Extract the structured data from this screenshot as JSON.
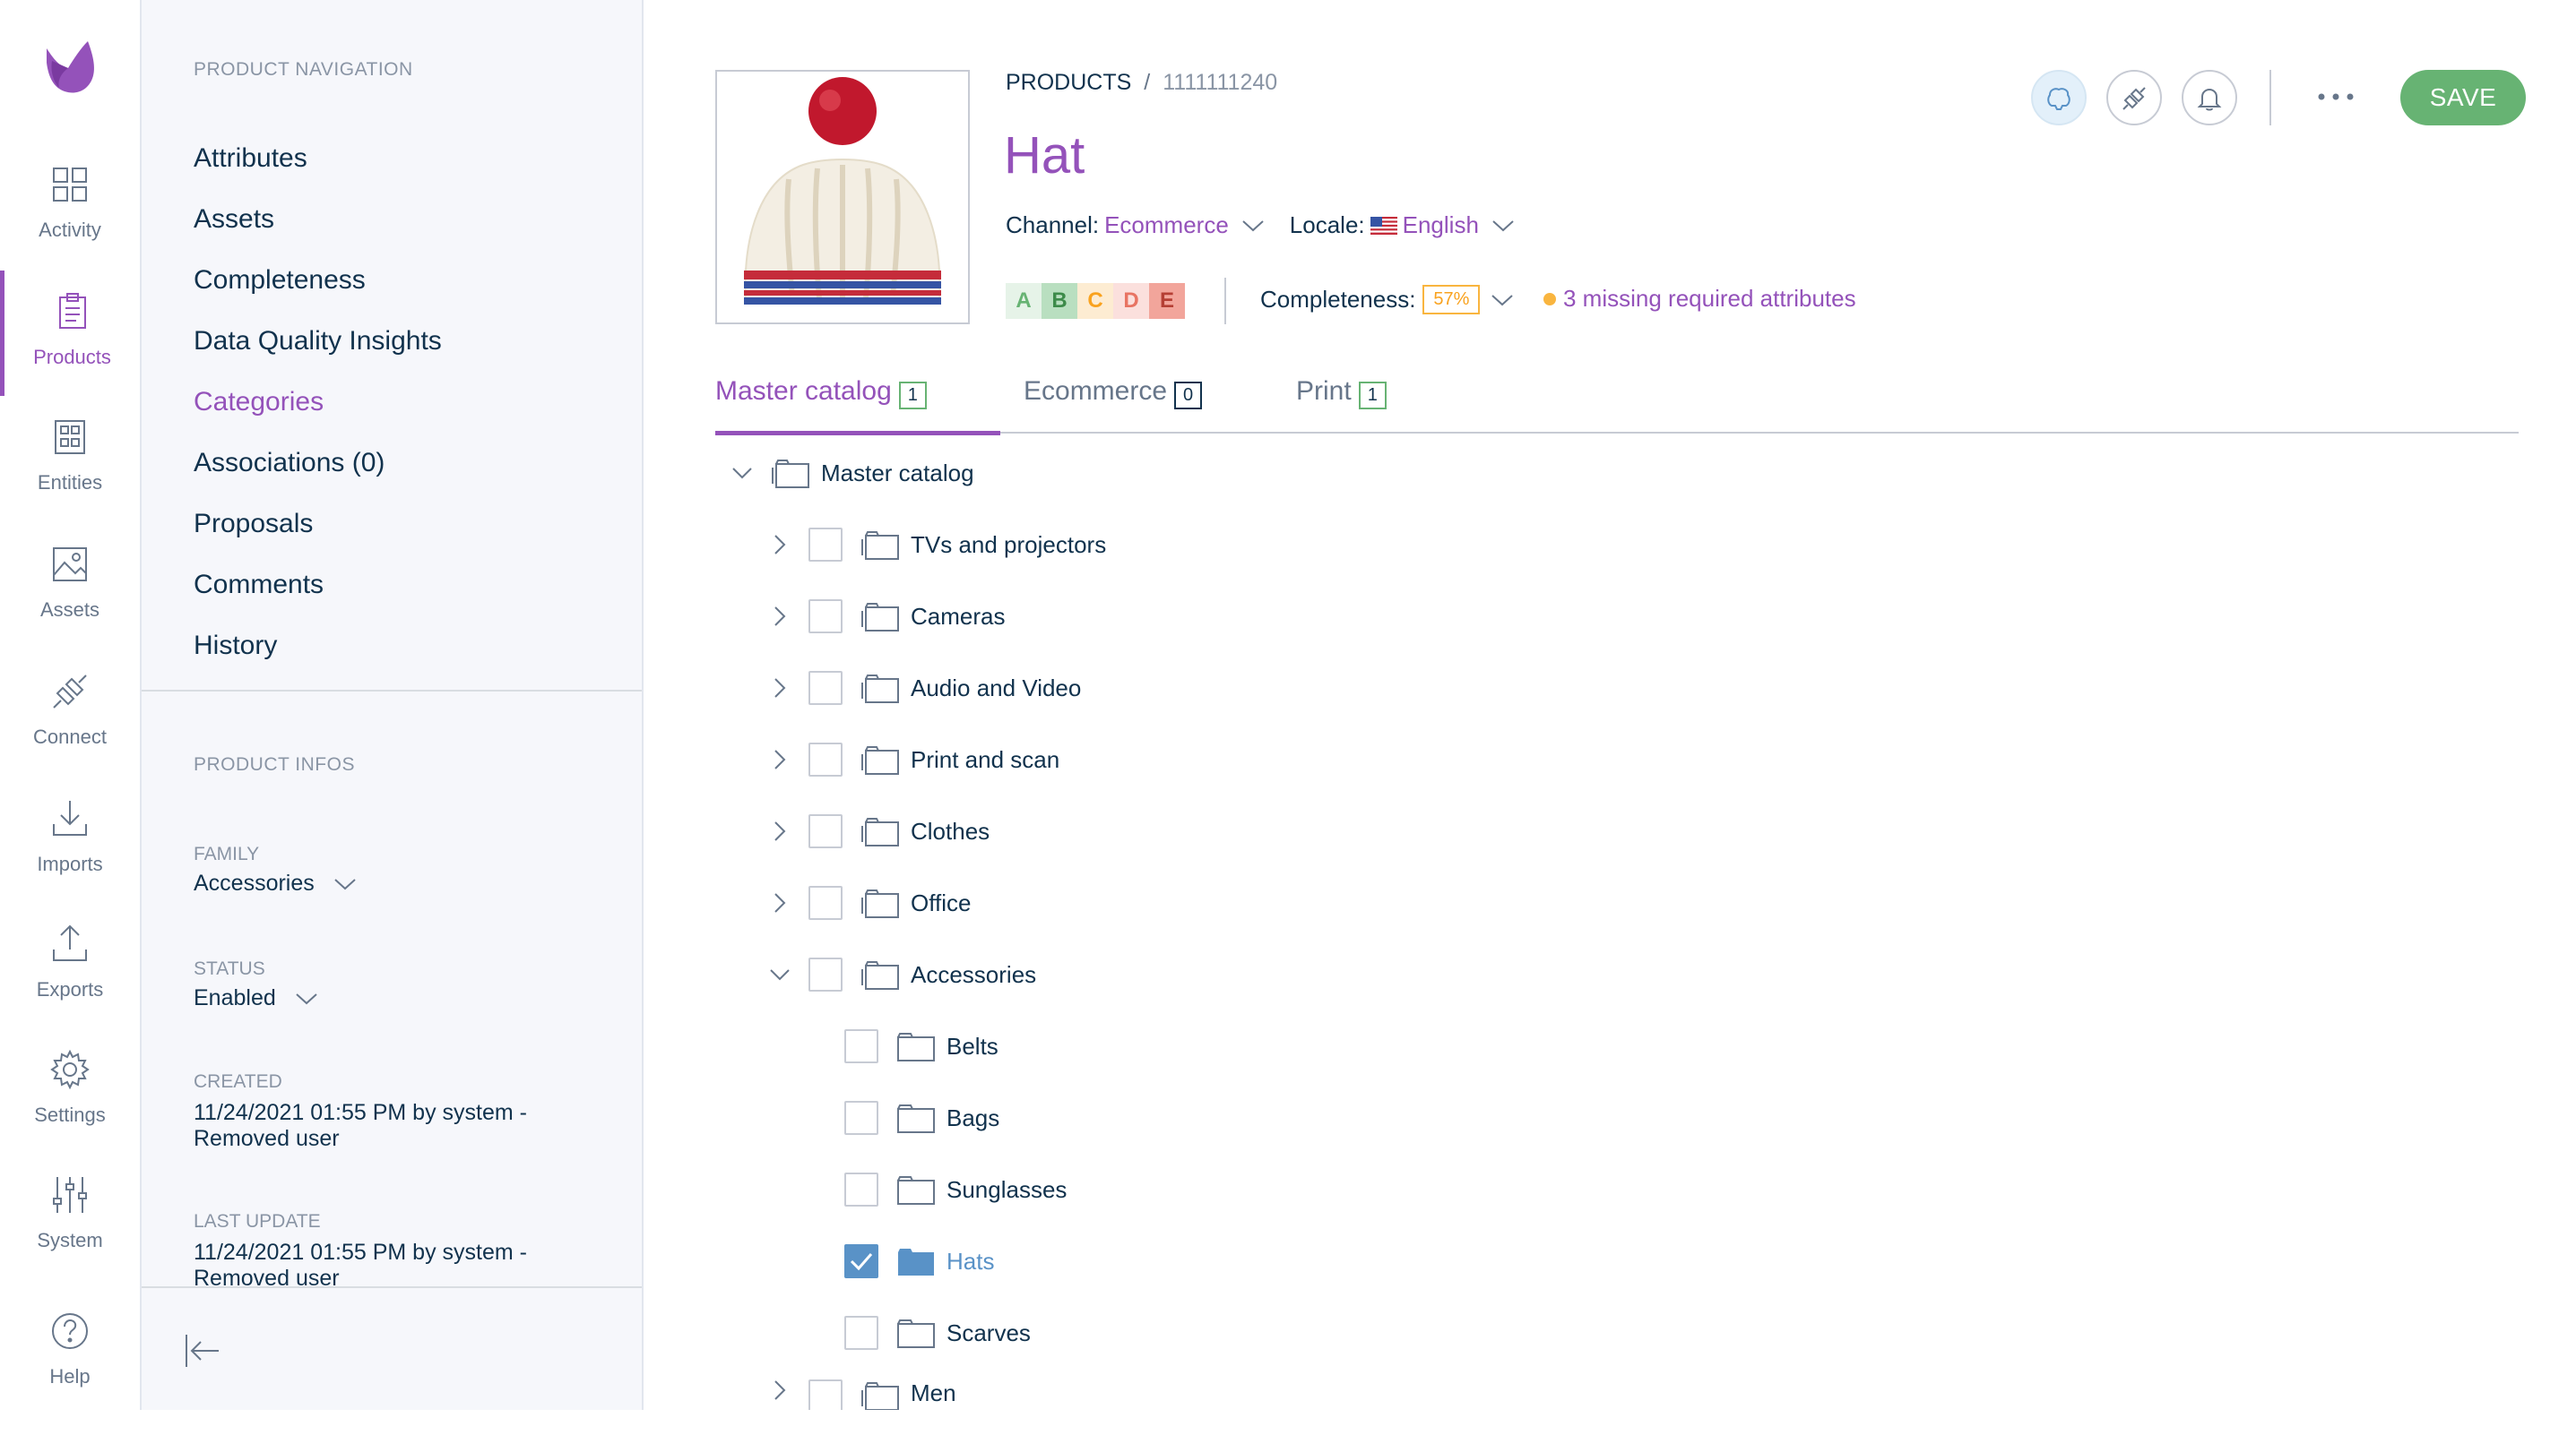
{
  "main_menu": {
    "items": [
      {
        "label": "Activity",
        "icon": "activity-icon"
      },
      {
        "label": "Products",
        "icon": "products-icon",
        "active": true
      },
      {
        "label": "Entities",
        "icon": "entities-icon"
      },
      {
        "label": "Assets",
        "icon": "assets-icon"
      },
      {
        "label": "Connect",
        "icon": "connect-icon"
      },
      {
        "label": "Imports",
        "icon": "imports-icon"
      },
      {
        "label": "Exports",
        "icon": "exports-icon"
      },
      {
        "label": "Settings",
        "icon": "settings-icon"
      },
      {
        "label": "System",
        "icon": "system-icon"
      }
    ],
    "help_label": "Help"
  },
  "product_nav": {
    "title": "PRODUCT NAVIGATION",
    "links": [
      {
        "label": "Attributes"
      },
      {
        "label": "Assets"
      },
      {
        "label": "Completeness"
      },
      {
        "label": "Data Quality Insights"
      },
      {
        "label": "Categories",
        "active": true
      },
      {
        "label": "Associations (0)"
      },
      {
        "label": "Proposals"
      },
      {
        "label": "Comments"
      },
      {
        "label": "History"
      }
    ]
  },
  "product_infos": {
    "title": "PRODUCT INFOS",
    "family_label": "FAMILY",
    "family_value": "Accessories",
    "status_label": "STATUS",
    "status_value": "Enabled",
    "created_label": "CREATED",
    "created_value": "11/24/2021 01:55 PM by system - Removed user",
    "updated_label": "LAST UPDATE",
    "updated_value": "11/24/2021 01:55 PM by system - Removed user"
  },
  "header": {
    "breadcrumb_root": "PRODUCTS",
    "breadcrumb_sep": "/",
    "breadcrumb_code": "1111111240",
    "title": "Hat",
    "channel_label": "Channel:",
    "channel_value": "Ecommerce",
    "locale_label": "Locale:",
    "locale_value": "English",
    "dqi_grades": [
      "A",
      "B",
      "C",
      "D",
      "E"
    ],
    "completeness_label": "Completeness:",
    "completeness_value": "57%",
    "missing_text": "3 missing required attributes",
    "save_label": "SAVE"
  },
  "tabs": [
    {
      "label": "Master catalog",
      "count": "1",
      "active": true
    },
    {
      "label": "Ecommerce",
      "count": "0"
    },
    {
      "label": "Print",
      "count": "1"
    }
  ],
  "tree": {
    "root": "Master catalog",
    "children": [
      {
        "label": "TVs and projectors"
      },
      {
        "label": "Cameras"
      },
      {
        "label": "Audio and Video"
      },
      {
        "label": "Print and scan"
      },
      {
        "label": "Clothes"
      },
      {
        "label": "Office"
      },
      {
        "label": "Accessories",
        "expanded": true
      }
    ],
    "accessories_children": [
      {
        "label": "Belts"
      },
      {
        "label": "Bags"
      },
      {
        "label": "Sunglasses"
      },
      {
        "label": "Hats",
        "checked": true
      },
      {
        "label": "Scarves"
      }
    ],
    "after": [
      {
        "label": "Men"
      }
    ]
  },
  "colors": {
    "accent": "#9452ba",
    "save_green": "#67b373",
    "selected_blue": "#5992c7",
    "warning_orange": "#f9b53f"
  }
}
